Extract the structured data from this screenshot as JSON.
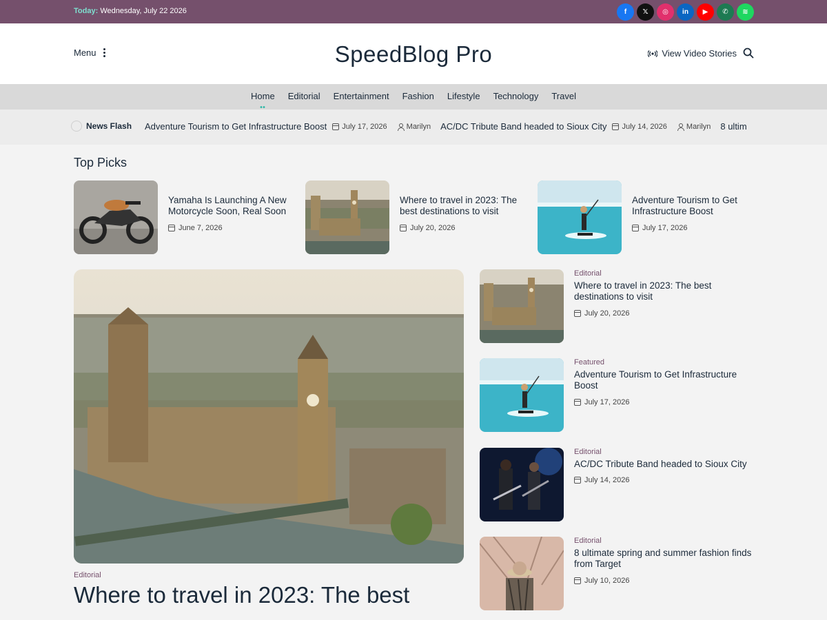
{
  "topbar": {
    "today_label": "Today:",
    "date": "Wednesday, July 22 2026",
    "social": [
      {
        "icon": "facebook-icon",
        "glyph": "f",
        "color": "#1877f2"
      },
      {
        "icon": "x-icon",
        "glyph": "𝕏",
        "color": "#111111"
      },
      {
        "icon": "instagram-icon",
        "glyph": "◎",
        "color": "#e1306c"
      },
      {
        "icon": "linkedin-icon",
        "glyph": "in",
        "color": "#0a66c2"
      },
      {
        "icon": "youtube-icon",
        "glyph": "▶",
        "color": "#ff0000"
      },
      {
        "icon": "whatsapp-icon",
        "glyph": "✆",
        "color": "#1d7a52"
      },
      {
        "icon": "spotify-icon",
        "glyph": "≋",
        "color": "#1ed760"
      }
    ]
  },
  "header": {
    "menu_label": "Menu",
    "site_title": "SpeedBlog Pro",
    "video_stories_label": "View Video Stories"
  },
  "nav": {
    "items": [
      "Home",
      "Editorial",
      "Entertainment",
      "Fashion",
      "Lifestyle",
      "Technology",
      "Travel"
    ],
    "active": "Home"
  },
  "news_flash": {
    "label": "News Flash",
    "items": [
      {
        "title": "Adventure Tourism to Get Infrastructure Boost",
        "date": "July 17, 2026",
        "author": "Marilyn"
      },
      {
        "title": "AC/DC Tribute Band headed to Sioux City",
        "date": "July 14, 2026",
        "author": "Marilyn"
      },
      {
        "title": "8 ultim"
      }
    ]
  },
  "top_picks": {
    "heading": "Top Picks",
    "items": [
      {
        "title": "Yamaha Is Launching A New Motorcycle Soon, Real Soon",
        "date": "June 7, 2026"
      },
      {
        "title": "Where to travel in 2023: The best destinations to visit",
        "date": "July 20, 2026"
      },
      {
        "title": "Adventure Tourism to Get Infrastructure Boost",
        "date": "July 17, 2026"
      }
    ]
  },
  "feature": {
    "category": "Editorial",
    "title": "Where to travel in 2023: The best"
  },
  "side_list": [
    {
      "category": "Editorial",
      "title": "Where to travel in 2023: The best destinations to visit",
      "date": "July 20, 2026"
    },
    {
      "category": "Featured",
      "title": "Adventure Tourism to Get Infrastructure Boost",
      "date": "July 17, 2026"
    },
    {
      "category": "Editorial",
      "title": "AC/DC Tribute Band headed to Sioux City",
      "date": "July 14, 2026"
    },
    {
      "category": "Editorial",
      "title": "8 ultimate spring and summer fashion finds from Target",
      "date": "July 10, 2026"
    }
  ],
  "colors": {
    "brand": "#75506c",
    "accent": "#2bb8a6",
    "text": "#1b2a3a"
  }
}
